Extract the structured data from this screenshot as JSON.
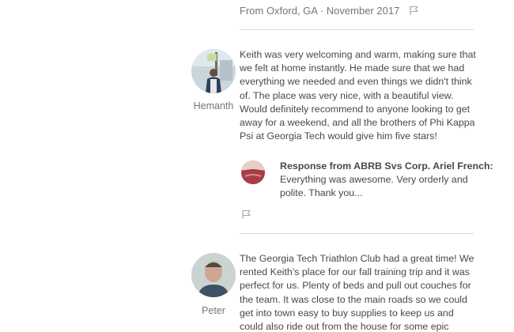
{
  "top_review_meta": {
    "location_date": "From Oxford, GA · November 2017",
    "flag_icon": "flag-icon"
  },
  "reviews": [
    {
      "reviewer": "Hemanth",
      "text": "Keith was very welcoming and warm, making sure that we felt at home instantly. He made sure that we had everything we needed and even things we didn't think of. The place was very nice, with a beautiful view. Would definitely recommend to anyone looking to get away for a weekend, and all the brothers of Phi Kappa Psi at Georgia Tech would give him five stars!",
      "response": {
        "title": "Response from ABRB Svs Corp. Ariel French:",
        "text": "Everything was awesome. Very orderly and polite. Thank you..."
      },
      "flag_icon": "flag-icon"
    },
    {
      "reviewer": "Peter",
      "text": "The Georgia Tech Triathlon Club had a great time! We rented Keith's place for our fall training trip and it was perfect for us. Plenty of beds and pull out couches for the team. It was close to the main roads so we could get into town easy to buy supplies to keep us and could also ride out from the house for some epic climbs in the"
    }
  ],
  "colors": {
    "text": "#484848",
    "muted": "#767676",
    "divider": "#dbdbdb"
  }
}
